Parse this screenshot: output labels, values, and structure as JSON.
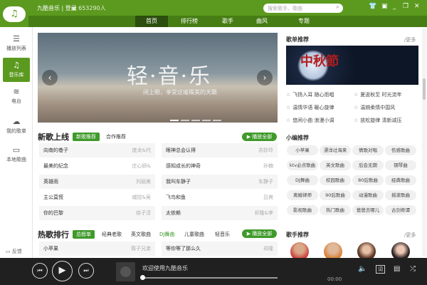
{
  "header": {
    "brand": "九酷音乐 | 登录",
    "online": "653290人",
    "search_placeholder": "搜索歌手、歌曲",
    "controls": [
      "skin",
      "mini",
      "minimize",
      "restore",
      "close"
    ]
  },
  "nav": {
    "tabs": [
      "首页",
      "排行榜",
      "歌手",
      "曲风",
      "专题"
    ],
    "active": 0
  },
  "sidebar": {
    "items": [
      {
        "label": "播放列表",
        "icon": "☰"
      },
      {
        "label": "音乐库",
        "icon": "♫"
      },
      {
        "label": "电台",
        "icon": "≋"
      },
      {
        "label": "我的歌单",
        "icon": "☁"
      },
      {
        "label": "本地歌曲",
        "icon": "▭"
      }
    ],
    "active": 1,
    "feedback": "反馈"
  },
  "banner": {
    "title": "轻·音·乐",
    "subtitle": "闭上眼，享受这璀璨美的天籁"
  },
  "new_songs": {
    "title": "新歌上线",
    "tabs": [
      "新歌推荐",
      "合作推荐"
    ],
    "play_all": "▶ 播放全部",
    "songs": [
      {
        "t": "向南的巷子",
        "a": "庞龙&代"
      },
      {
        "t": "眼神总会认得",
        "a": "苏妙玲"
      },
      {
        "t": "最美的纪念",
        "a": "庄心妍&"
      },
      {
        "t": "感知成长的神奇",
        "a": "孙楠"
      },
      {
        "t": "英雄雨",
        "a": "刘丽美"
      },
      {
        "t": "我叫车静子",
        "a": "车静子"
      },
      {
        "t": "主公莫慌",
        "a": "威控&吴"
      },
      {
        "t": "飞鸟和鱼",
        "a": "吕爽"
      },
      {
        "t": "你的巴黎",
        "a": "徐子淳"
      },
      {
        "t": "太依赖",
        "a": "祁隆&李"
      }
    ]
  },
  "hot_songs": {
    "title": "热歌排行",
    "tabs": [
      "总榜单",
      "经典老歌",
      "英文歌曲",
      "DJ舞曲",
      "儿童歌曲",
      "轻音乐"
    ],
    "play_all": "▶ 播放全部",
    "songs": [
      {
        "t": "小苹果",
        "a": "筷子兄弟"
      },
      {
        "t": "等你等了那么久",
        "a": "祁隆"
      }
    ]
  },
  "playlists": {
    "title": "歌单推荐",
    "more": "/更多",
    "image_text": "中秋節",
    "items": [
      "飞扬入耳 随心而唱",
      "夏逝秋至 时光流年",
      "温情华语 暖心旋律",
      "温婉柔情中国风",
      "悠闲小曲 浪漫小调",
      "放松旋律 清新减压"
    ]
  },
  "editor": {
    "title": "小编推荐",
    "tags": [
      "小苹果",
      "漂洋过海来",
      "情歌对唱",
      "伤感歌曲",
      "ktv必点歌曲",
      "英文歌曲",
      "后会无期",
      "钢琴曲",
      "DJ舞曲",
      "校园歌曲",
      "80后歌曲",
      "经典歌曲",
      "离婚律师",
      "90后歌曲",
      "动漫歌曲",
      "摇滚歌曲",
      "影视歌曲",
      "热门歌曲",
      "爸爸去哪儿",
      "古剑奇谭"
    ]
  },
  "singers": {
    "title": "歌手推荐",
    "more": "/更多"
  },
  "player": {
    "now_playing": "欢迎使用九酷音乐",
    "time": "00:00",
    "progress": 0,
    "lyrics": "词"
  }
}
